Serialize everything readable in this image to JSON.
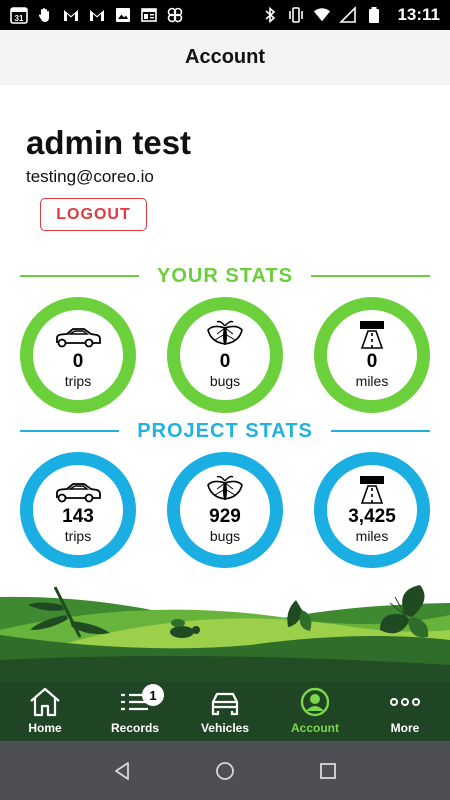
{
  "status_bar": {
    "time": "13:11",
    "calendar_day": "31",
    "icons_left": [
      "calendar-icon",
      "hand-icon",
      "gmail-icon",
      "gmail-icon",
      "image-icon",
      "news-icon",
      "pinwheel-icon"
    ],
    "icons_right": [
      "bluetooth-icon",
      "vibrate-icon",
      "wifi-icon",
      "signal-icon",
      "battery-icon"
    ]
  },
  "header": {
    "title": "Account"
  },
  "user": {
    "name": "admin test",
    "email": "testing@coreo.io",
    "logout_label": "LOGOUT"
  },
  "your_stats": {
    "title": "YOUR STATS",
    "color": "#6cce3a",
    "items": [
      {
        "value": "0",
        "label": "trips",
        "icon": "car-icon"
      },
      {
        "value": "0",
        "label": "bugs",
        "icon": "moth-icon"
      },
      {
        "value": "0",
        "label": "miles",
        "icon": "road-icon"
      }
    ]
  },
  "project_stats": {
    "title": "PROJECT STATS",
    "color": "#21b1e0",
    "items": [
      {
        "value": "143",
        "label": "trips",
        "icon": "car-icon"
      },
      {
        "value": "929",
        "label": "bugs",
        "icon": "moth-icon"
      },
      {
        "value": "3,425",
        "label": "miles",
        "icon": "road-icon"
      }
    ]
  },
  "tabs": [
    {
      "label": "Home",
      "icon": "home-icon",
      "active": false
    },
    {
      "label": "Records",
      "icon": "list-icon",
      "active": false,
      "badge": "1"
    },
    {
      "label": "Vehicles",
      "icon": "car-icon",
      "active": false
    },
    {
      "label": "Account",
      "icon": "user-circle-icon",
      "active": true
    },
    {
      "label": "More",
      "icon": "more-dots-icon",
      "active": false
    }
  ],
  "colors": {
    "tab_bar": "#204525",
    "active_tab": "#7bd84a",
    "logout": "#e0393e",
    "nav_bar": "#4d4f54"
  }
}
